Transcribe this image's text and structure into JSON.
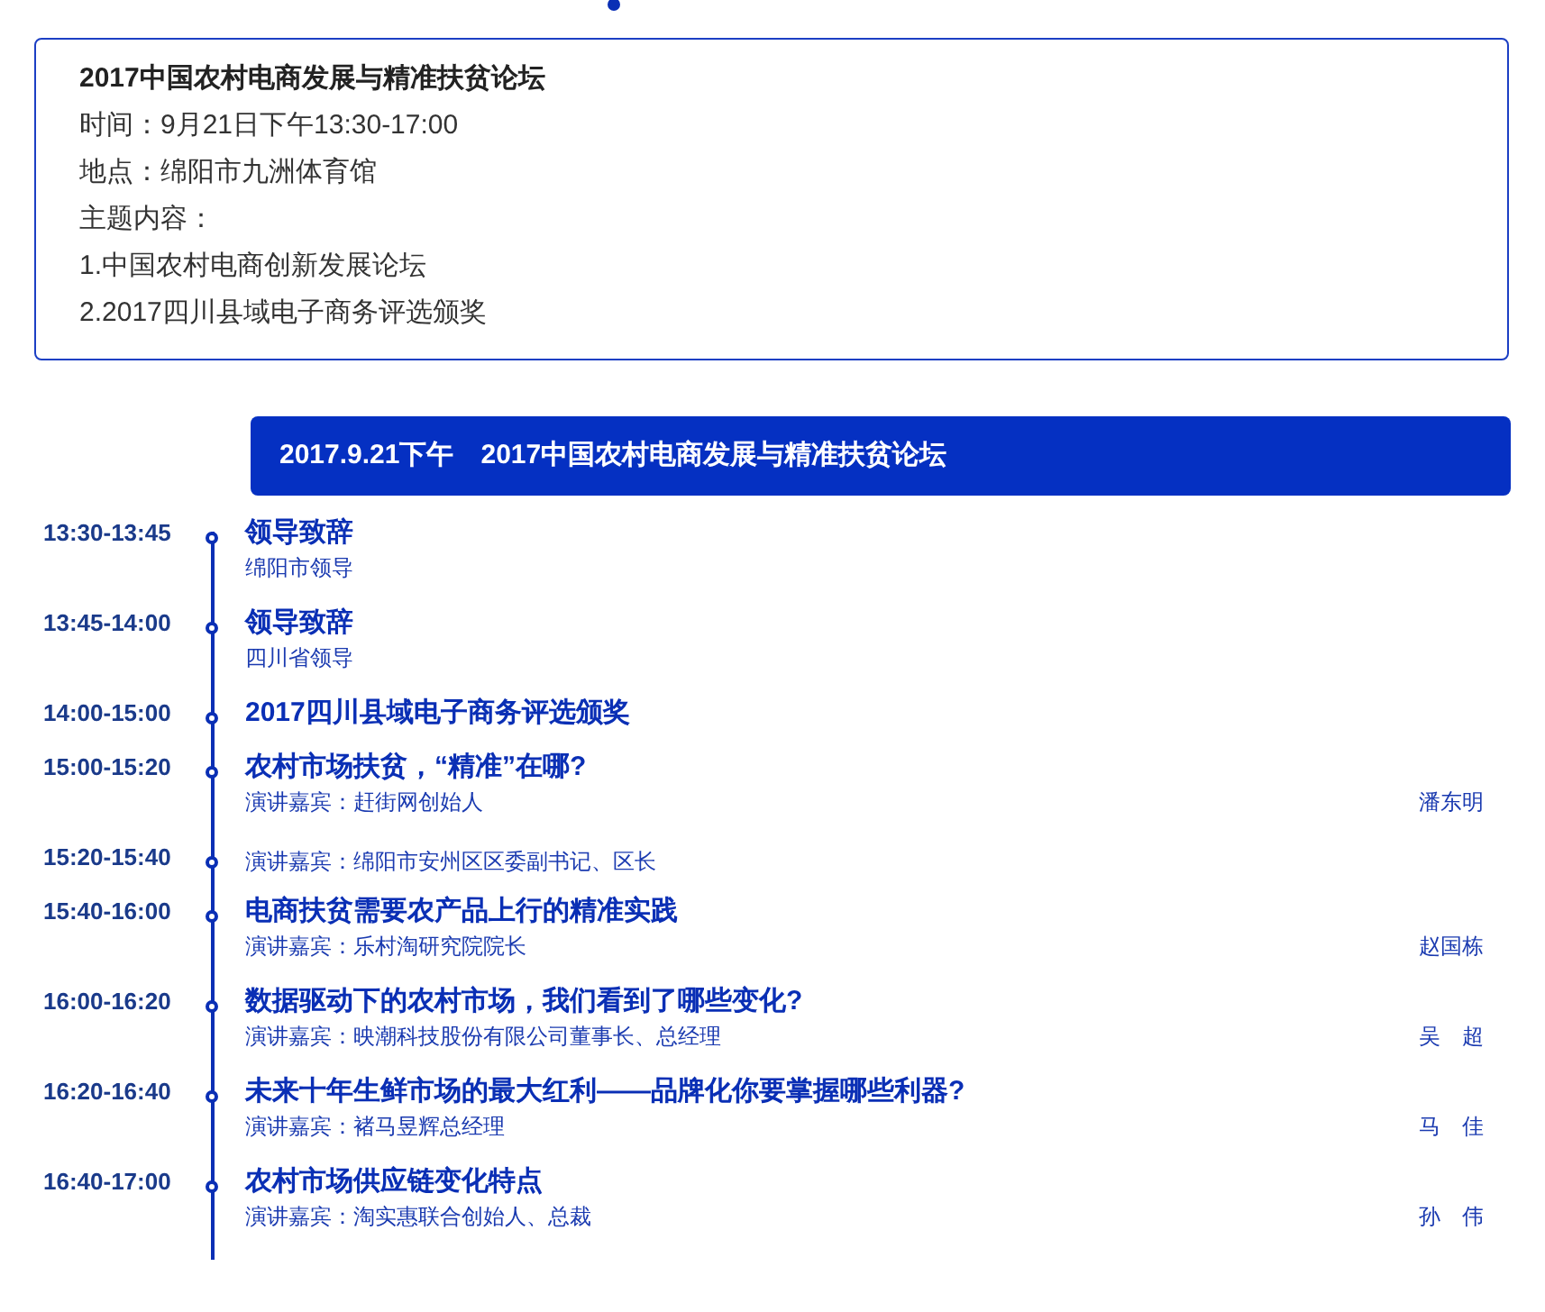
{
  "info_card": {
    "title": "2017中国农村电商发展与精准扶贫论坛",
    "lines": [
      "时间：9月21日下午13:30-17:00",
      "地点：绵阳市九洲体育馆",
      "主题内容：",
      "1.中国农村电商创新发展论坛",
      "2.2017四川县域电子商务评选颁奖"
    ]
  },
  "agenda": {
    "header": "2017.9.21下午　2017中国农村电商发展与精准扶贫论坛",
    "items": [
      {
        "time": "13:30-13:45",
        "title": "领导致辞",
        "subtitle": "绵阳市领导"
      },
      {
        "time": "13:45-14:00",
        "title": "领导致辞",
        "subtitle": "四川省领导"
      },
      {
        "time": "14:00-15:00",
        "title": "2017四川县域电子商务评选颁奖"
      },
      {
        "time": "15:00-15:20",
        "title": "农村市场扶贫，“精准”在哪?",
        "subtitle": "演讲嘉宾：赶街网创始人",
        "speaker": "潘东明"
      },
      {
        "time": "15:20-15:40",
        "subtitle": "演讲嘉宾：绵阳市安州区区委副书记、区长"
      },
      {
        "time": "15:40-16:00",
        "title": "电商扶贫需要农产品上行的精准实践",
        "subtitle": "演讲嘉宾：乐村淘研究院院长",
        "speaker": "赵国栋"
      },
      {
        "time": "16:00-16:20",
        "title": "数据驱动下的农村市场，我们看到了哪些变化?",
        "subtitle": "演讲嘉宾：映潮科技股份有限公司董事长、总经理",
        "speaker": "吴　超"
      },
      {
        "time": "16:20-16:40",
        "title": "未来十年生鲜市场的最大红利——品牌化你要掌握哪些利器?",
        "subtitle": "演讲嘉宾：褚马昱辉总经理",
        "speaker": "马　佳"
      },
      {
        "time": "16:40-17:00",
        "title": "农村市场供应链变化特点",
        "subtitle": "演讲嘉宾：淘实惠联合创始人、总裁",
        "speaker": "孙　伟"
      }
    ]
  }
}
